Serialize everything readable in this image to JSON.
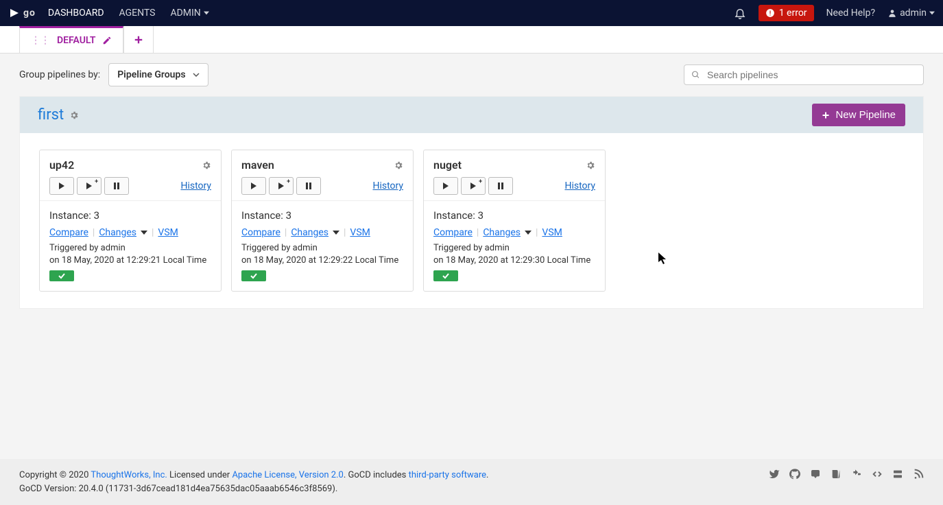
{
  "nav": {
    "brand": "go",
    "items": [
      "DASHBOARD",
      "AGENTS",
      "ADMIN"
    ],
    "error_count": "1 error",
    "help": "Need Help?",
    "user": "admin"
  },
  "tabs": {
    "active": "DEFAULT"
  },
  "toolbar": {
    "group_label": "Group pipelines by:",
    "group_select": "Pipeline Groups",
    "search_placeholder": "Search pipelines"
  },
  "group": {
    "name": "first",
    "new_pipeline_btn": "New Pipeline"
  },
  "pipelines": [
    {
      "name": "up42",
      "history": "History",
      "instance_label": "Instance: 3",
      "compare": "Compare",
      "changes": "Changes",
      "vsm": "VSM",
      "triggered_by": "Triggered by admin",
      "triggered_on": "on 18 May, 2020 at 12:29:21 Local Time"
    },
    {
      "name": "maven",
      "history": "History",
      "instance_label": "Instance: 3",
      "compare": "Compare",
      "changes": "Changes",
      "vsm": "VSM",
      "triggered_by": "Triggered by admin",
      "triggered_on": "on 18 May, 2020 at 12:29:22 Local Time"
    },
    {
      "name": "nuget",
      "history": "History",
      "instance_label": "Instance: 3",
      "compare": "Compare",
      "changes": "Changes",
      "vsm": "VSM",
      "triggered_by": "Triggered by admin",
      "triggered_on": "on 18 May, 2020 at 12:29:30 Local Time"
    }
  ],
  "footer": {
    "copyright_prefix": "Copyright © 2020 ",
    "thoughtworks": "ThoughtWorks, Inc.",
    "licensed": " Licensed under ",
    "apache": "Apache License, Version 2.0",
    "includes": ". GoCD includes ",
    "thirdparty": "third-party software",
    "period": ".",
    "version": "GoCD Version: 20.4.0 (11731-3d67cead181d4ea75635dac05aaab6546c3f8569)."
  }
}
